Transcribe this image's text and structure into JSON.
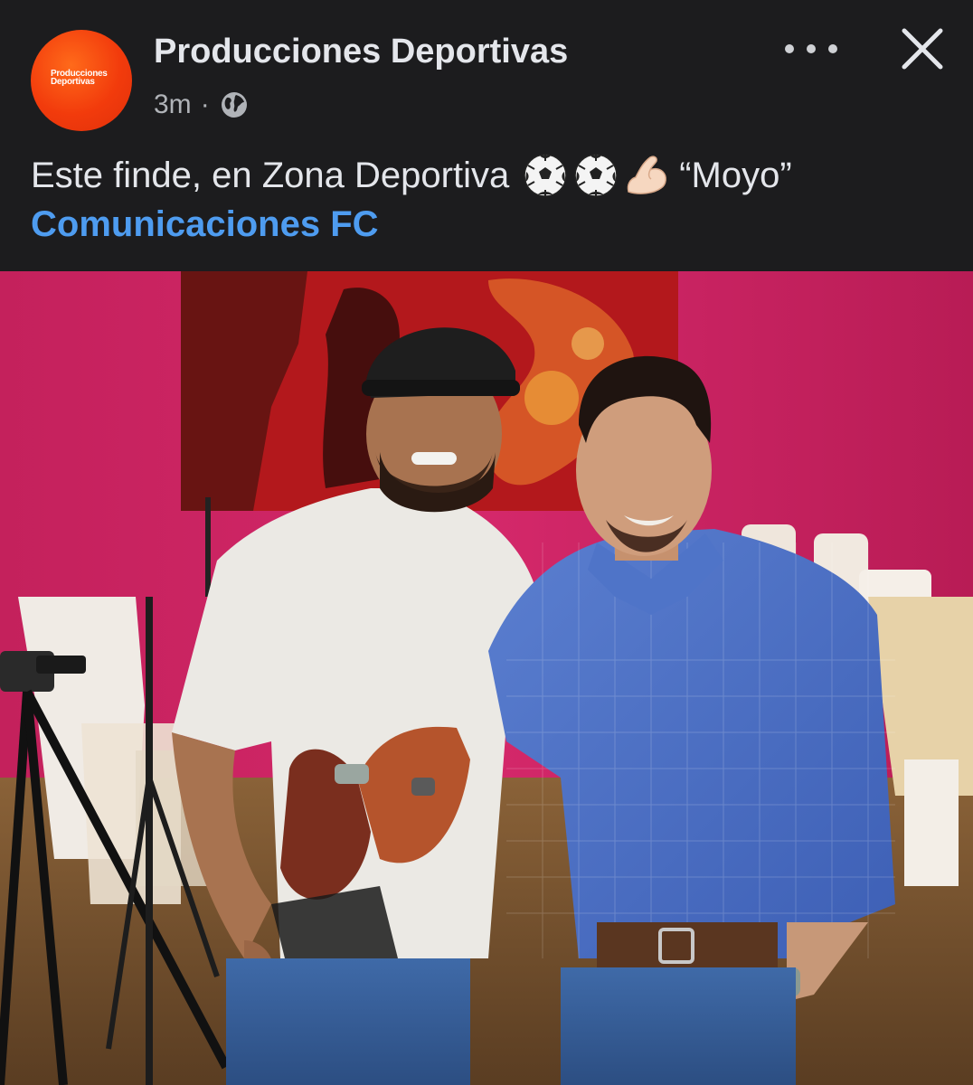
{
  "post": {
    "page_name": "Producciones Deportivas",
    "avatar_text": "Producciones Deportivas",
    "time": "3m",
    "separator": "·",
    "audience_icon": "globe-icon",
    "caption_text": "Este finde, en Zona Deportiva",
    "caption_emojis": [
      "soccer-ball",
      "soccer-ball",
      "flexed-biceps"
    ],
    "caption_quote": "“Moyo”",
    "hashtag": "Comunicaciones FC"
  },
  "controls": {
    "more_icon": "more-icon",
    "close_icon": "close-icon"
  },
  "colors": {
    "background": "#1c1c1e",
    "text_primary": "#e4e6eb",
    "text_secondary": "#b0b3b8",
    "link": "#4e9cf0",
    "avatar": "#f23b0c"
  },
  "photo": {
    "subject": "two-men-posing"
  }
}
